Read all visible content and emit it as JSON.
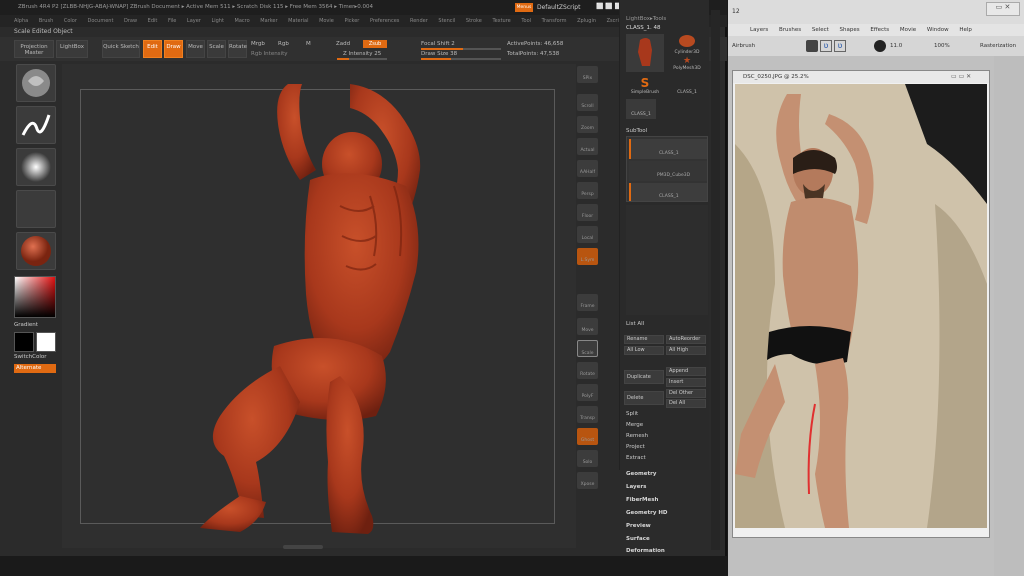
{
  "zbrush": {
    "title": "ZBrush 4R4 P2 [ZLBB-NHJG-ABAJ-WNAP]   ZBrush Document   ▸ Active Mem 511 ▸ Scratch Disk 115 ▸ Free Mem 3564 ▸ Timer▸0.004",
    "hide_btn": "Menus",
    "script_btn": "DefaultZScript",
    "menu": [
      "Alpha",
      "Brush",
      "Color",
      "Document",
      "Draw",
      "Edit",
      "File",
      "Layer",
      "Light",
      "Macro",
      "Marker",
      "Material",
      "Movie",
      "Picker",
      "Preferences",
      "Render",
      "Stencil",
      "Stroke",
      "Texture",
      "Tool",
      "Transform",
      "Zplugin",
      "Zscript"
    ],
    "status": "Scale Edited Object",
    "toolbar": {
      "projection_master": "Projection Master",
      "lightbox": "LightBox",
      "quick_sketch": "Quick Sketch",
      "edit": "Edit",
      "draw": "Draw",
      "move": "Move",
      "scale": "Scale",
      "rotate": "Rotate",
      "mrgb": "Mrgb",
      "rgb": "Rgb",
      "m": "M",
      "zadd": "Zadd",
      "zsub": "Zsub",
      "rgb_intensity": "Rgb Intensity",
      "z_intensity": "Z Intensity 25",
      "focal_shift": "Focal Shift 2",
      "draw_size": "Draw Size 38",
      "active_points": "ActivePoints: 46,658",
      "total_points": "TotalPoints: 47,538"
    },
    "left_shelf": {
      "gradient": "Gradient",
      "switch_color": "SwitchColor",
      "alternate": "Alternate"
    },
    "right_shelf": [
      "SPix",
      "Scroll",
      "Zoom",
      "Actual",
      "AAHalf",
      "Persp",
      "Floor",
      "Local",
      "L.Sym",
      "Frame",
      "Move",
      "Scale",
      "Rotate",
      "PolyF",
      "Transp",
      "Ghost",
      "Solo",
      "Xpose"
    ],
    "tool_panel": {
      "title": "LightBox▸Tools",
      "current_tool": "CLASS_1. 48",
      "tools": [
        "CLASS_1",
        "Cylinder3D",
        "SimpleBrush",
        "PolyMesh3D",
        "CLASS_1",
        "CLASS_1"
      ],
      "subtool_header": "SubTool",
      "subtools": [
        "CLASS_1",
        "PM3D_Cube3D",
        "CLASS_1"
      ],
      "list_all": "List All",
      "rename": "Rename",
      "auto_reorder": "AutoReorder",
      "all_low": "All Low",
      "all_high": "All High",
      "duplicate": "Duplicate",
      "append": "Append",
      "insert": "Insert",
      "delete": "Delete",
      "del_other": "Del Other",
      "del_all": "Del All",
      "split": "Split",
      "merge": "Merge",
      "remesh": "Remesh",
      "project": "Project",
      "extract": "Extract"
    },
    "menu_sections": [
      "Geometry",
      "Layers",
      "FiberMesh",
      "Geometry HD",
      "Preview",
      "Surface",
      "Deformation"
    ]
  },
  "photoshop": {
    "title_suffix": "12",
    "menu": [
      "Layers",
      "Brushes",
      "Select",
      "Shapes",
      "Effects",
      "Movie",
      "Window",
      "Help"
    ],
    "tool_label": "Airbrush",
    "size": "11.0",
    "opacity": "100%",
    "flow": "100%",
    "rasterization": "Rasterization",
    "doc_title": "DSC_0250.JPG @ 25.2%"
  },
  "colors": {
    "accent": "#e06a12",
    "clay": "#a8381c",
    "zb_bg": "#2b2b2b"
  }
}
